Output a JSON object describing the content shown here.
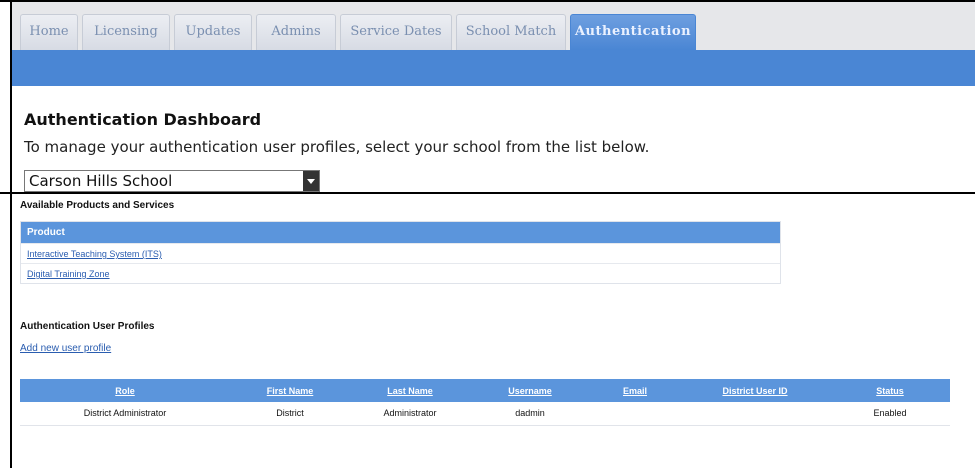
{
  "tabs": [
    {
      "label": "Home",
      "active": false
    },
    {
      "label": "Licensing",
      "active": false
    },
    {
      "label": "Updates",
      "active": false
    },
    {
      "label": "Admins",
      "active": false
    },
    {
      "label": "Service Dates",
      "active": false
    },
    {
      "label": "School Match",
      "active": false
    },
    {
      "label": "Authentication",
      "active": true
    }
  ],
  "dashboard": {
    "title": "Authentication Dashboard",
    "instructions": "To manage your authentication user profiles, select your school from the list below.",
    "school_select": {
      "value": "Carson Hills School"
    }
  },
  "products": {
    "section_title": "Available Products and Services",
    "column_header": "Product",
    "items": [
      "Interactive Teaching System (ITS)",
      "Digital Training Zone"
    ]
  },
  "profiles": {
    "section_title": "Authentication User Profiles",
    "add_link": "Add new user profile",
    "columns": [
      "Role",
      "First Name",
      "Last Name",
      "Username",
      "Email",
      "District User ID",
      "Status"
    ],
    "rows": [
      {
        "role": "District Administrator",
        "first_name": "District",
        "last_name": "Administrator",
        "username": "dadmin",
        "email": "",
        "district_user_id": "",
        "status": "Enabled"
      }
    ]
  },
  "colors": {
    "accent": "#4a86d4",
    "header_blue": "#5b95dc",
    "link": "#2a5db0"
  }
}
